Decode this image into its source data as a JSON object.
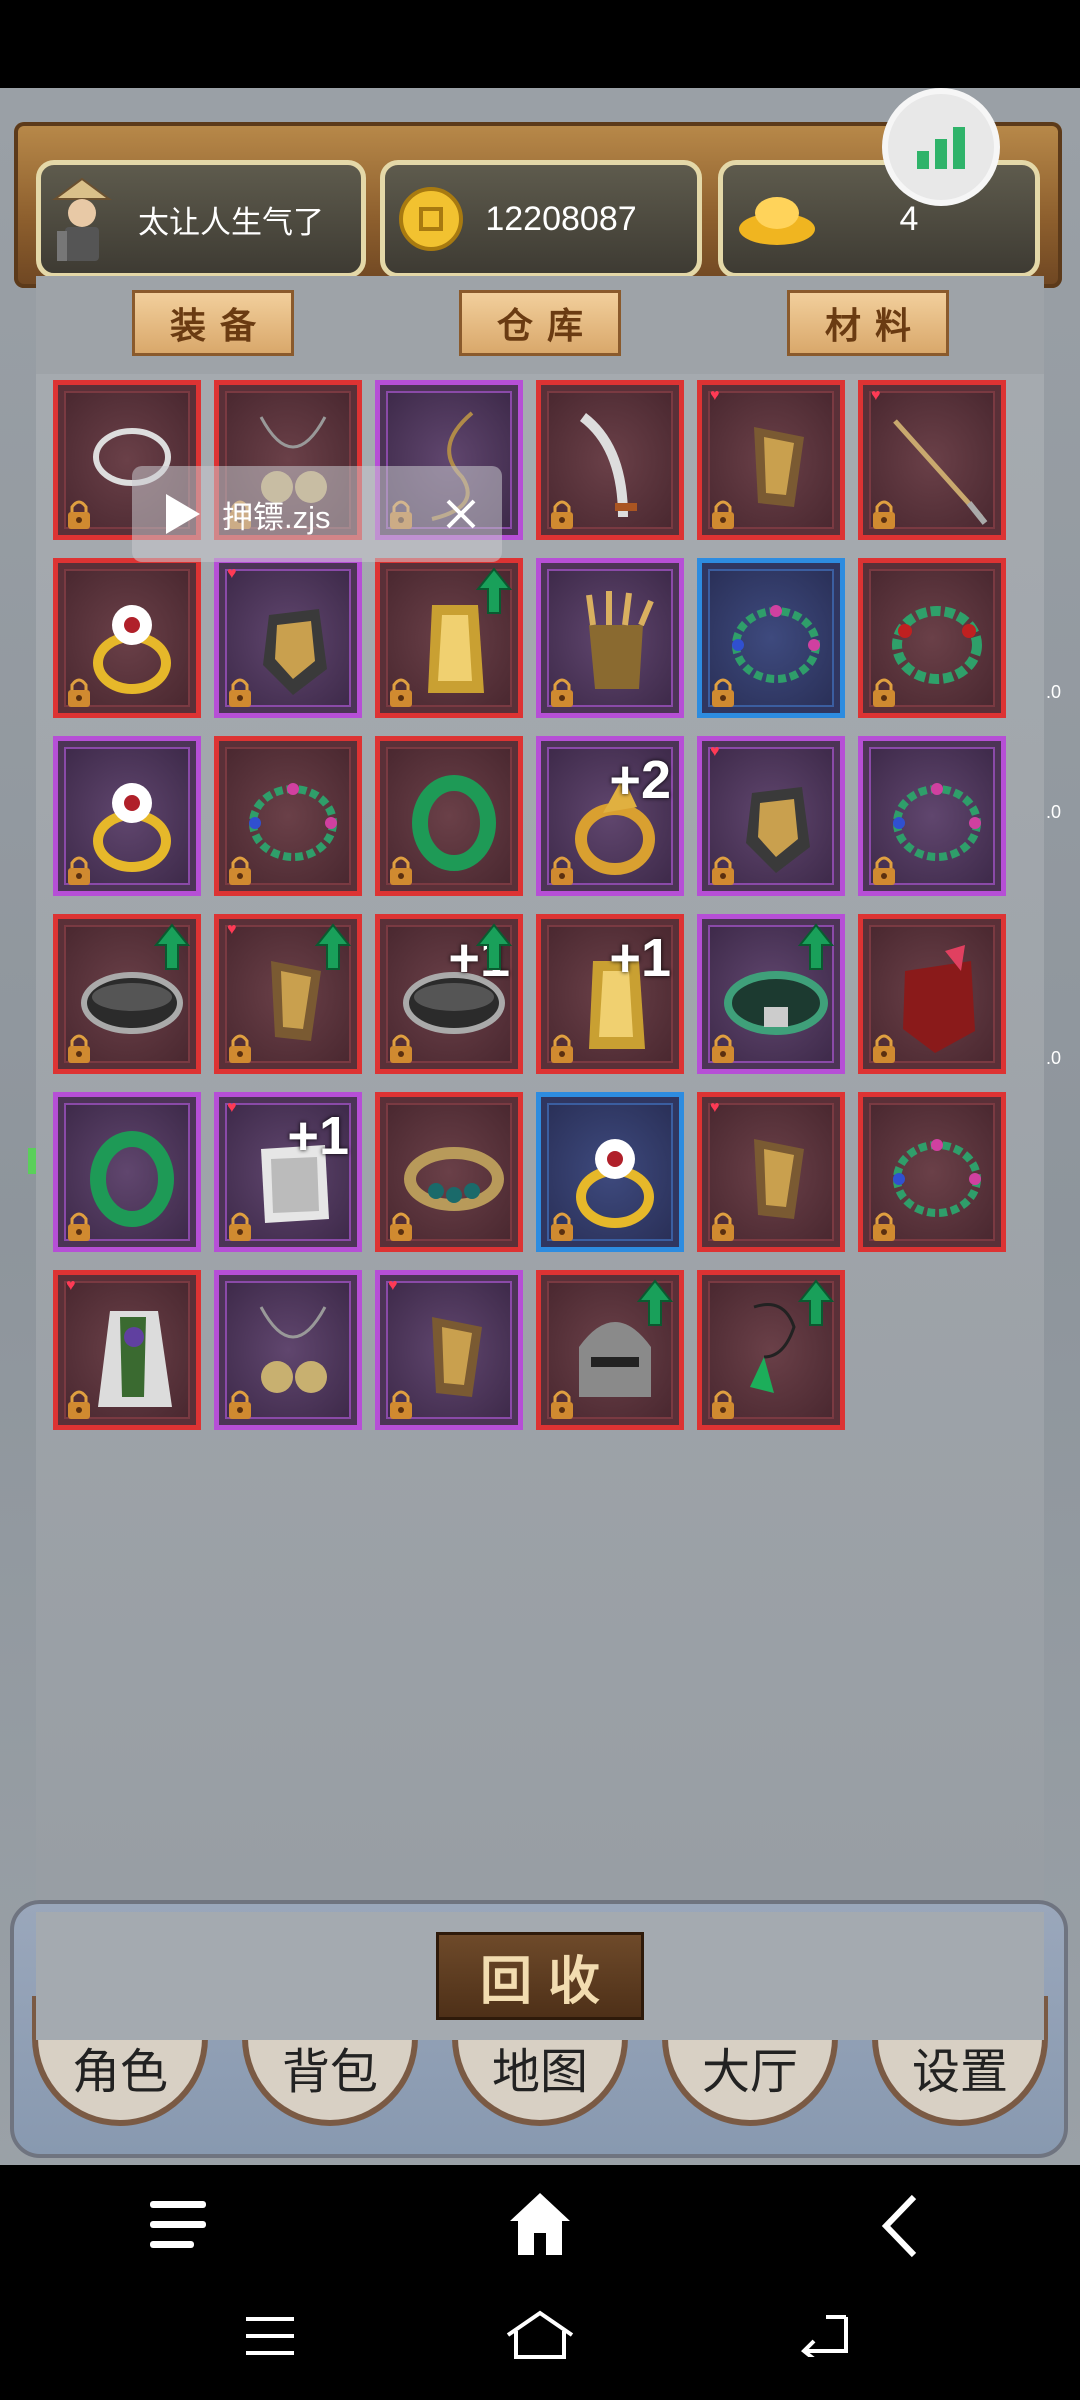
{
  "header": {
    "player_name": "太让人生气了",
    "coins": "12208087",
    "gold_ingots": "4"
  },
  "tabs": [
    {
      "label": "装备"
    },
    {
      "label": "仓库"
    },
    {
      "label": "材料"
    }
  ],
  "toast": {
    "filename": "押镖.zjs"
  },
  "inventory": [
    {
      "item": "silver-necklace",
      "frame": "red"
    },
    {
      "item": "bell-necklace",
      "frame": "red"
    },
    {
      "item": "whip-necklace",
      "frame": "purple"
    },
    {
      "item": "curved-sword",
      "frame": "red",
      "heart": false
    },
    {
      "item": "armor-gauntlet",
      "frame": "red",
      "heart": true
    },
    {
      "item": "spear",
      "frame": "red",
      "heart": true
    },
    {
      "item": "flower-ring",
      "frame": "red"
    },
    {
      "item": "armor-set",
      "frame": "purple",
      "heart": true
    },
    {
      "item": "golden-glove",
      "frame": "red",
      "upgrade": true
    },
    {
      "item": "claw-glove",
      "frame": "purple"
    },
    {
      "item": "gem-bracelet",
      "frame": "blue"
    },
    {
      "item": "jade-bead-bracelet",
      "frame": "red"
    },
    {
      "item": "flower-ring",
      "frame": "purple"
    },
    {
      "item": "gem-bracelet",
      "frame": "red"
    },
    {
      "item": "jade-ring",
      "frame": "red"
    },
    {
      "item": "dragon-ring",
      "frame": "purple",
      "plus": "+2"
    },
    {
      "item": "armor-set",
      "frame": "purple",
      "heart": true
    },
    {
      "item": "gem-bracelet",
      "frame": "purple"
    },
    {
      "item": "iron-belt",
      "frame": "red",
      "upgrade": true
    },
    {
      "item": "armor-gauntlet",
      "frame": "red",
      "upgrade": true,
      "heart": true
    },
    {
      "item": "iron-belt",
      "frame": "red",
      "upgrade": true,
      "plus": "+1"
    },
    {
      "item": "golden-glove",
      "frame": "red",
      "plus": "+1"
    },
    {
      "item": "jade-belt",
      "frame": "purple",
      "upgrade": true
    },
    {
      "item": "crimson-armor",
      "frame": "red"
    },
    {
      "item": "jade-ring",
      "frame": "purple"
    },
    {
      "item": "silver-gauntlet",
      "frame": "purple",
      "plus": "+1",
      "heart": true
    },
    {
      "item": "jeweled-cuff",
      "frame": "red"
    },
    {
      "item": "flower-ring",
      "frame": "blue"
    },
    {
      "item": "armor-gauntlet",
      "frame": "red",
      "heart": true
    },
    {
      "item": "gem-bracelet",
      "frame": "red"
    },
    {
      "item": "robe",
      "frame": "red",
      "heart": true
    },
    {
      "item": "bell-necklace",
      "frame": "purple"
    },
    {
      "item": "armor-gauntlet",
      "frame": "purple",
      "heart": true
    },
    {
      "item": "iron-helmet",
      "frame": "red",
      "upgrade": true
    },
    {
      "item": "jade-pendant",
      "frame": "red",
      "upgrade": true
    }
  ],
  "actions": {
    "recycle_label": "回收"
  },
  "bottom_nav": [
    {
      "label": "角色"
    },
    {
      "label": "背包"
    },
    {
      "label": "地图"
    },
    {
      "label": "大厅"
    },
    {
      "label": "设置"
    }
  ],
  "colors": {
    "frame_red": "#d33333",
    "frame_purple": "#b64fd6",
    "frame_blue": "#2d8ce0",
    "upgrade_green": "#19a05a"
  }
}
